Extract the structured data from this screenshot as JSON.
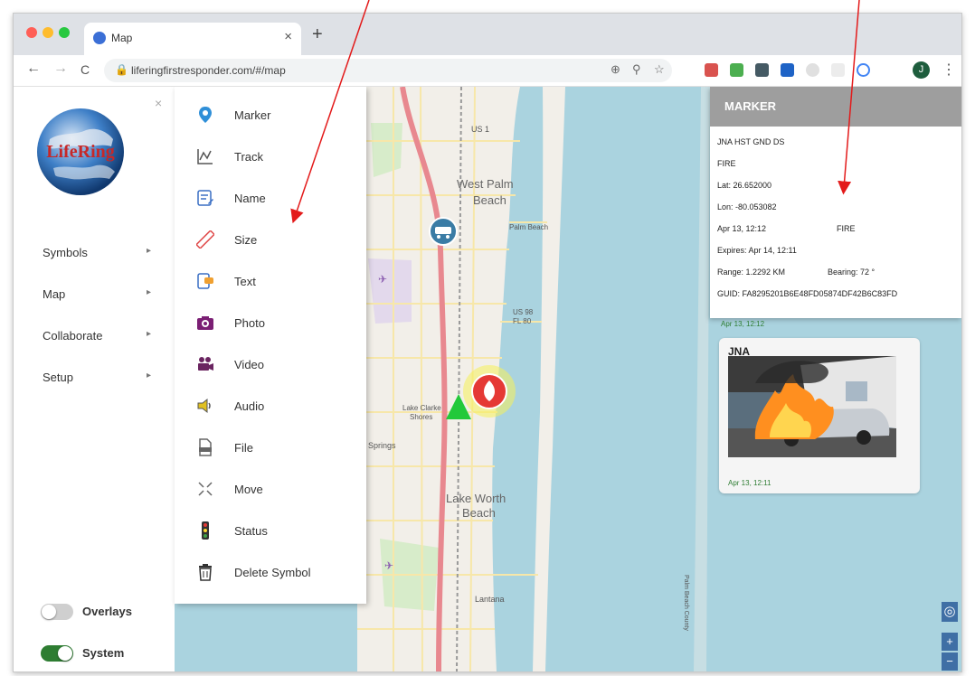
{
  "browser": {
    "tab_title": "Map",
    "tab_close": "×",
    "new_tab": "+",
    "url": "liferingfirstresponder.com/#/map",
    "nav": {
      "back": "←",
      "forward": "→",
      "reload": "C"
    },
    "menu": "⋮",
    "avatar_letter": "J",
    "traffic_light_colors": [
      "#ff5f57",
      "#febc2e",
      "#28c840"
    ]
  },
  "sidebar": {
    "logo_text": "LifeRing",
    "close_label": "×",
    "items": [
      {
        "label": "Symbols",
        "chevron": "▸"
      },
      {
        "label": "Map",
        "chevron": "▸"
      },
      {
        "label": "Collaborate",
        "chevron": "▸"
      },
      {
        "label": "Setup",
        "chevron": "▸"
      }
    ],
    "toggles": [
      {
        "label": "Overlays",
        "on": false
      },
      {
        "label": "System",
        "on": true
      }
    ],
    "toggle_on_color": "#2e7d32"
  },
  "submenu": {
    "items": [
      {
        "label": "Marker",
        "icon": "map-pin-icon"
      },
      {
        "label": "Track",
        "icon": "track-chart-icon"
      },
      {
        "label": "Name",
        "icon": "edit-name-icon"
      },
      {
        "label": "Size",
        "icon": "ruler-icon"
      },
      {
        "label": "Text",
        "icon": "text-note-icon"
      },
      {
        "label": "Photo",
        "icon": "camera-icon"
      },
      {
        "label": "Video",
        "icon": "video-camera-icon"
      },
      {
        "label": "Audio",
        "icon": "speaker-icon"
      },
      {
        "label": "File",
        "icon": "file-icon"
      },
      {
        "label": "Move",
        "icon": "move-arrows-icon"
      },
      {
        "label": "Status",
        "icon": "traffic-light-icon"
      },
      {
        "label": "Delete Symbol",
        "icon": "trash-icon"
      }
    ]
  },
  "map": {
    "labels": [
      {
        "text": "US 1"
      },
      {
        "text": "West Palm"
      },
      {
        "text": "Beach"
      },
      {
        "text": "Palm Beach"
      },
      {
        "text": "US 98"
      },
      {
        "text": "FL 80"
      },
      {
        "text": "Lake Clarke"
      },
      {
        "text": "Shores"
      },
      {
        "text": "Springs"
      },
      {
        "text": "Lake Worth"
      },
      {
        "text": "Beach"
      },
      {
        "text": "Lantana"
      },
      {
        "text": "Palm Beach County"
      }
    ],
    "controls": {
      "locate": "◎",
      "zoom_in": "+",
      "zoom_out": "−"
    },
    "water_color": "#aad3df",
    "land_color": "#f2efe9",
    "fire_marker_color": "#e53935",
    "marker_halo_color": "#f5f05a",
    "vehicle_marker_color": "#3a7ca5",
    "triangle_color": "#22c93a"
  },
  "marker_panel": {
    "header": "MARKER",
    "lines": {
      "name": "JNA HST GND DS",
      "type": "FIRE",
      "lat": "Lat: 26.652000",
      "lon": "Lon: -80.053082",
      "time": "Apr 13, 12:12",
      "time_type": "FIRE",
      "expires": "Expires: Apr 14, 12:11",
      "range": "Range: 1.2292 KM",
      "bearing": "Bearing: 72 °",
      "guid": "GUID: FA8295201B6E48FD05874DF42B6C83FD"
    },
    "chat_time_1": "Apr 13, 12:12",
    "chat_sender": "JNA",
    "chat_time_2": "Apr 13, 12:11",
    "header_color": "#9e9e9e"
  }
}
